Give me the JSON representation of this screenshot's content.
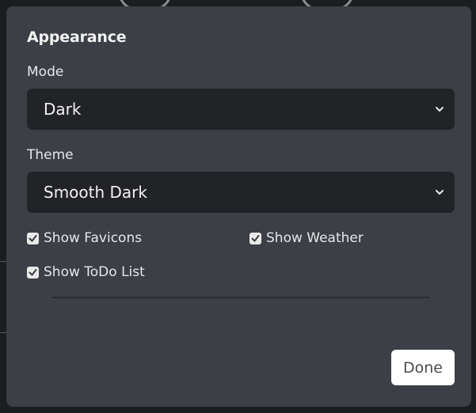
{
  "dialog": {
    "title": "Appearance",
    "mode": {
      "label": "Mode",
      "selected": "Dark"
    },
    "theme": {
      "label": "Theme",
      "selected": "Smooth Dark"
    },
    "options": {
      "favicons": {
        "label": "Show Favicons",
        "checked": true
      },
      "weather": {
        "label": "Show Weather",
        "checked": true
      },
      "todo": {
        "label": "Show ToDo List",
        "checked": true
      }
    },
    "done_label": "Done"
  },
  "colors": {
    "modal_bg": "#3c3f45",
    "select_bg": "#212327",
    "text": "#e6e7e9",
    "button_bg": "#ffffff"
  }
}
